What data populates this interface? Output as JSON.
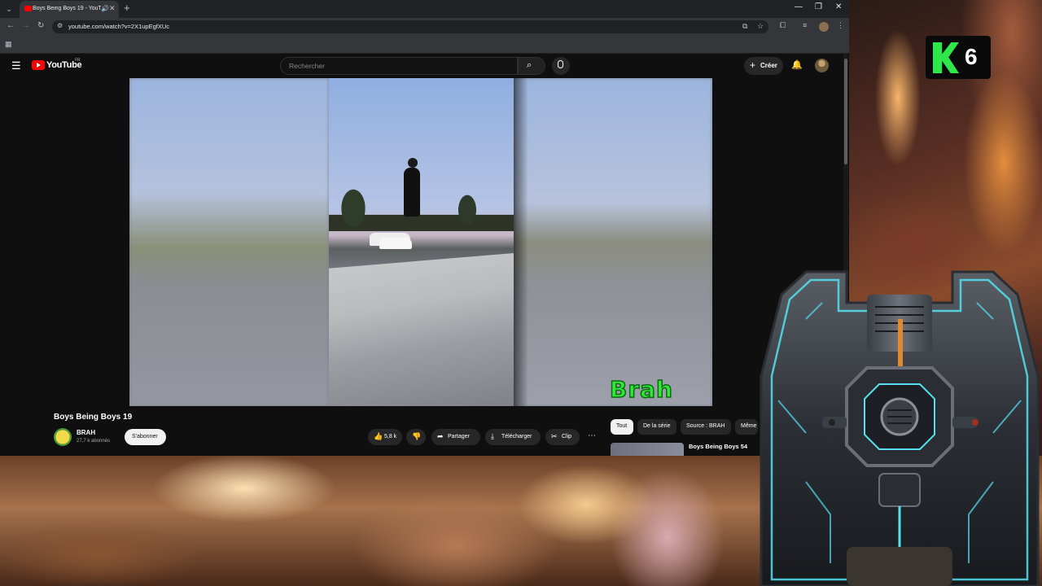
{
  "browser": {
    "tab_title": "Boys Being Boys 19 - YouTube",
    "url": "youtube.com/watch?v=2X1upEgfXUc"
  },
  "youtube": {
    "logo_text": "YouTube",
    "country": "FR",
    "search_placeholder": "Rechercher",
    "create_label": "Créer",
    "video": {
      "watermark": "Brah",
      "title": "Boys Being Boys 19",
      "channel_name": "BRAH",
      "subscribers": "27,7 k abonnés",
      "subscribe_label": "S'abonner",
      "likes": "5,8 k",
      "share_label": "Partager",
      "download_label": "Télécharger",
      "clip_label": "Clip"
    },
    "chips": [
      "Tout",
      "De la série",
      "Source : BRAH",
      "Même"
    ],
    "recommendation_title": "Boys Being Boys 54"
  },
  "overlay": {
    "badge_number": "6"
  },
  "colors": {
    "yt_red": "#ff0000",
    "watermark_green": "#33e63d",
    "badge_green": "#2ee84b"
  }
}
